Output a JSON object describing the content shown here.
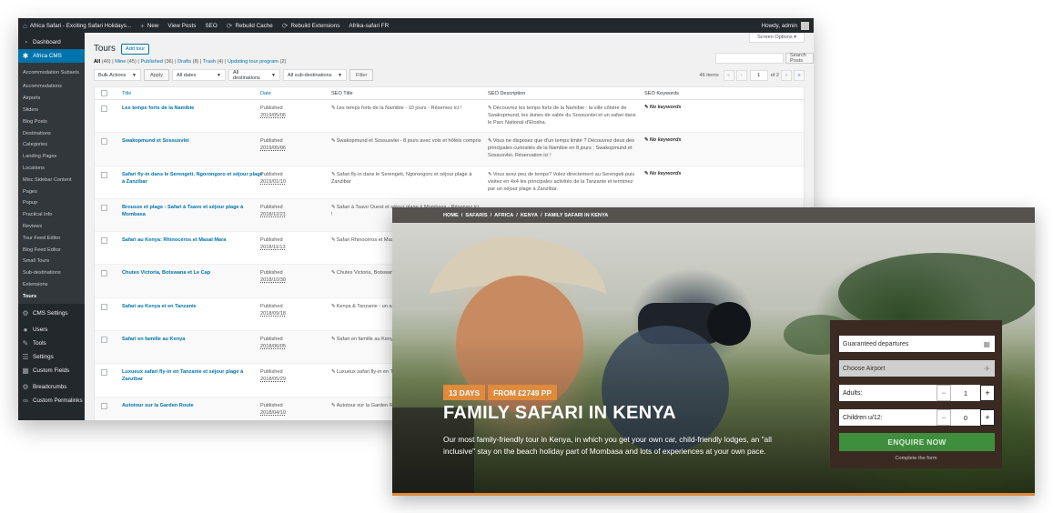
{
  "admin_bar": {
    "site_name": "Africa Safari - Exciting Safari Holidays...",
    "new": "New",
    "view_posts": "View Posts",
    "seo": "SEO",
    "rebuild_cache": "Rebuild Cache",
    "rebuild_extensions": "Rebuild Extensions",
    "site_fr": "Afrika-safari FR",
    "howdy": "Howdy, admin"
  },
  "sidebar": {
    "dashboard": "Dashboard",
    "africa_cms": "Africa CMS",
    "submenu": [
      "Accommodation Subsets",
      "Accommodations",
      "Airports",
      "Sliders",
      "Blog Posts",
      "Destinations",
      "Categories",
      "Landing Pages",
      "Locations",
      "Misc Sidebar Content",
      "Pages",
      "Popup",
      "Practical Info",
      "Reviews",
      "Tour Feed Editor",
      "Blog Feed Editor",
      "Small Tours",
      "Sub-destinations",
      "Extensions",
      "Tours"
    ],
    "cms_settings": "CMS Settings",
    "users": "Users",
    "tools": "Tools",
    "settings": "Settings",
    "custom_fields": "Custom Fields",
    "breadcrumbs": "Breadcrumbs",
    "custom_permalinks": "Custom Permalinks"
  },
  "page": {
    "title": "Tours",
    "add_tour": "Add tour",
    "screen_options": "Screen Options ▾",
    "filters": {
      "all": "All",
      "all_count": "(46)",
      "mine": "Mine",
      "mine_count": "(45)",
      "published": "Published",
      "published_count": "(36)",
      "drafts": "Drafts",
      "drafts_count": "(8)",
      "trash": "Trash",
      "trash_count": "(4)",
      "updating": "Updating tour program",
      "updating_count": "(2)"
    },
    "search_button": "Search Posts",
    "bulk_actions": "Bulk Actions",
    "apply": "Apply",
    "all_dates": "All dates",
    "all_destinations": "All destinations",
    "all_subdestinations": "All sub-destinations",
    "filter": "Filter",
    "items_count": "46 items",
    "page_current": "1",
    "page_total": "of 2"
  },
  "table": {
    "headers": {
      "title": "Title",
      "date": "Date",
      "seo_title": "SEO Title",
      "seo_description": "SEO Description",
      "seo_keywords": "SEO Keywords"
    },
    "rows": [
      {
        "title": "Les temps forts de la Namibie",
        "status": "Published",
        "date": "2019/05/06",
        "seo_title": "Les temps forts de la Namibie - 10 jours - Réservez ici !",
        "seo_description": "Découvrez les temps forts de la Namibie : la ville côtière de Swakopmund, les dunes de sable du Sossusvlei et un safari dans le Parc National d'Etosha.",
        "seo_keywords": "No keywords"
      },
      {
        "title": "Swakopmund et Sossusvlei",
        "status": "Published",
        "date": "2019/05/06",
        "seo_title": "Swakopmund et Sossusvlei - 8 jours avec vols et hôtels compris",
        "seo_description": "Vous ne disposez que d'un temps limité ? Découvrez deux des principales curiosités de la Namibie en 8 jours : Swakopmund et Sossusvlei. Réservation ici !",
        "seo_keywords": "No keywords"
      },
      {
        "title": "Safari fly-in dans le Serengeti, Ngorongoro et séjour plage à Zanzibar",
        "status": "Published",
        "date": "2019/01/10",
        "seo_title": "Safari fly-in dans le Serengeti, Ngorongoro et séjour plage à Zanzibar",
        "seo_description": "Vous avez peu de temps? Volez directement au Serengeti puis visitez en 4x4 les principales activités de la Tanzanie et terminez par un séjour plage à Zanzibar.",
        "seo_keywords": "No keywords"
      },
      {
        "title": "Brousse et plage : Safari à Tsavo et séjour plage à Mombasa",
        "status": "Published",
        "date": "2018/12/21",
        "seo_title": "Safari à Tsavo Ouest et séjour plage à Mombasa - Réservez ici !",
        "seo_description": "",
        "seo_keywords": ""
      },
      {
        "title": "Safari au Kenya: Rhinocéros et Masaï Mara",
        "status": "Published",
        "date": "2018/11/13",
        "seo_title": "Safari Rhinocéros et Masaï Mara - plus de détails ici !",
        "seo_description": "",
        "seo_keywords": ""
      },
      {
        "title": "Chutes Victoria, Botswana et Le Cap",
        "status": "Published",
        "date": "2018/10/30",
        "seo_title": "Chutes Victoria, Botswana et Le Cap - programme ici !",
        "seo_description": "",
        "seo_keywords": ""
      },
      {
        "title": "Safari au Kenya et en Tanzanie",
        "status": "Published",
        "date": "2018/09/18",
        "seo_title": "Kenya & Tanzanie - un safari mémorable !",
        "seo_description": "",
        "seo_keywords": ""
      },
      {
        "title": "Safari en famille au Kenya",
        "status": "Published",
        "date": "2018/06/05",
        "seo_title": "Safari en famille au Kenya",
        "seo_description": "",
        "seo_keywords": ""
      },
      {
        "title": "Luxueux safari fly-in en Tanzanie et séjour plage à Zanzibar",
        "status": "Published",
        "date": "2018/05/29",
        "seo_title": "Luxueux safari fly-in en Tanzanie",
        "seo_description": "",
        "seo_keywords": ""
      },
      {
        "title": "Autotour sur la Garden Route",
        "status": "Published",
        "date": "2018/04/10",
        "seo_title": "Autotour sur la Garden Route en Afrique du Sud.",
        "seo_description": "",
        "seo_keywords": ""
      }
    ]
  },
  "site": {
    "breadcrumb": [
      "HOME",
      "/",
      "SAFARIS",
      "/",
      "AFRICA",
      "/",
      "KENYA",
      "/",
      "FAMILY SAFARI IN KENYA"
    ],
    "badge_days": "13 DAYS",
    "badge_price": "FROM £2749 PP",
    "title": "FAMILY SAFARI IN KENYA",
    "description": "Our most family-friendly tour in Kenya, in which you get your own car, child-friendly lodges, an \"all inclusive\" stay on the beach holiday part of Mombasa and lots of experiences at your own pace.",
    "booking": {
      "departures": "Guaranteed departures",
      "airport": "Choose Airport",
      "adults_label": "Adults:",
      "adults_value": "1",
      "children_label": "Children u/12:",
      "children_value": "0",
      "minus": "−",
      "plus": "+",
      "enquire": "ENQUIRE NOW",
      "complete": "Complete the form"
    }
  },
  "colors": {
    "wp_dark": "#23282d",
    "wp_blue": "#0073aa",
    "accent_orange": "#e08a3c",
    "enquire_green": "#3e8e3e",
    "booking_bg": "#3a2a22"
  }
}
